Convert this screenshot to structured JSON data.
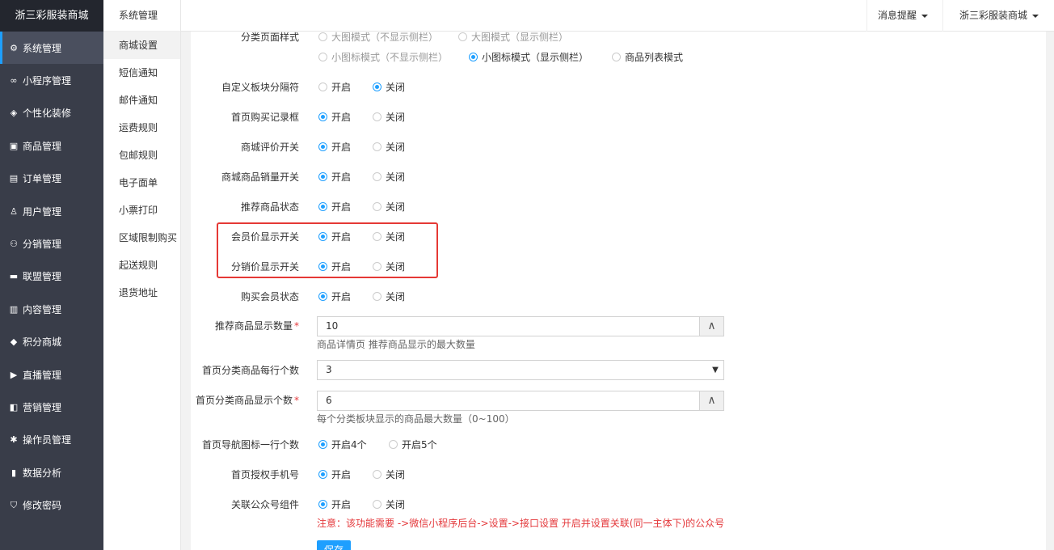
{
  "sidebar": {
    "brand": "浙三彩服装商城",
    "items": [
      {
        "label": "系统管理",
        "icon": "gear-icon",
        "glyph": "⚙"
      },
      {
        "label": "小程序管理",
        "icon": "link-icon",
        "glyph": "∞"
      },
      {
        "label": "个性化装修",
        "icon": "diamond-icon",
        "glyph": "◈"
      },
      {
        "label": "商品管理",
        "icon": "bag-icon",
        "glyph": "▣"
      },
      {
        "label": "订单管理",
        "icon": "clipboard-icon",
        "glyph": "▤"
      },
      {
        "label": "用户管理",
        "icon": "user-icon",
        "glyph": "♙"
      },
      {
        "label": "分销管理",
        "icon": "sitemap-icon",
        "glyph": "⚇"
      },
      {
        "label": "联盟管理",
        "icon": "card-icon",
        "glyph": "▬"
      },
      {
        "label": "内容管理",
        "icon": "news-icon",
        "glyph": "▥"
      },
      {
        "label": "积分商城",
        "icon": "cube-icon",
        "glyph": "◆"
      },
      {
        "label": "直播管理",
        "icon": "play-icon",
        "glyph": "▶"
      },
      {
        "label": "营销管理",
        "icon": "megaphone-icon",
        "glyph": "◧"
      },
      {
        "label": "操作员管理",
        "icon": "cog-icon",
        "glyph": "✱"
      },
      {
        "label": "数据分析",
        "icon": "bar-chart-icon",
        "glyph": "▮"
      },
      {
        "label": "修改密码",
        "icon": "shield-icon",
        "glyph": "⛉"
      }
    ]
  },
  "subnav": {
    "title": "系统管理",
    "items": [
      "商城设置",
      "短信通知",
      "邮件通知",
      "运费规则",
      "包邮规则",
      "电子面单",
      "小票打印",
      "区域限制购买",
      "起送规则",
      "退货地址"
    ]
  },
  "header": {
    "notify": "消息提醒",
    "shop": "浙三彩服装商城"
  },
  "form": {
    "category_style": {
      "label": "分类页面样式",
      "options": [
        "大图模式（不显示侧栏）",
        "大图模式（显示侧栏）",
        "小图标模式（不显示侧栏）",
        "小图标模式（显示侧栏）",
        "商品列表模式"
      ]
    },
    "on": "开启",
    "off": "关闭",
    "toggles": [
      {
        "label": "自定义板块分隔符",
        "value": "off"
      },
      {
        "label": "首页购买记录框",
        "value": "on"
      },
      {
        "label": "商城评价开关",
        "value": "on"
      },
      {
        "label": "商城商品销量开关",
        "value": "on"
      },
      {
        "label": "推荐商品状态",
        "value": "on"
      },
      {
        "label": "会员价显示开关",
        "value": "on"
      },
      {
        "label": "分销价显示开关",
        "value": "on"
      },
      {
        "label": "购买会员状态",
        "value": "on"
      }
    ],
    "recommend_count": {
      "label": "推荐商品显示数量",
      "value": "10",
      "hint": "商品详情页 推荐商品显示的最大数量"
    },
    "per_row": {
      "label": "首页分类商品每行个数",
      "value": "3"
    },
    "category_count": {
      "label": "首页分类商品显示个数",
      "value": "6",
      "hint": "每个分类板块显示的商品最大数量（0~100）"
    },
    "nav_icons": {
      "label": "首页导航图标一行个数",
      "opt1": "开启4个",
      "opt2": "开启5个"
    },
    "auth_phone": {
      "label": "首页授权手机号",
      "value": "on"
    },
    "official": {
      "label": "关联公众号组件",
      "value": "on",
      "warn": "注意：该功能需要 ->微信小程序后台->设置->接口设置 开启并设置关联(同一主体下)的公众号"
    },
    "save": "保存"
  },
  "colors": {
    "accent": "#1e9fff",
    "sidebar": "#393d49",
    "warn": "#e4393c",
    "highlight": "#e53935"
  }
}
